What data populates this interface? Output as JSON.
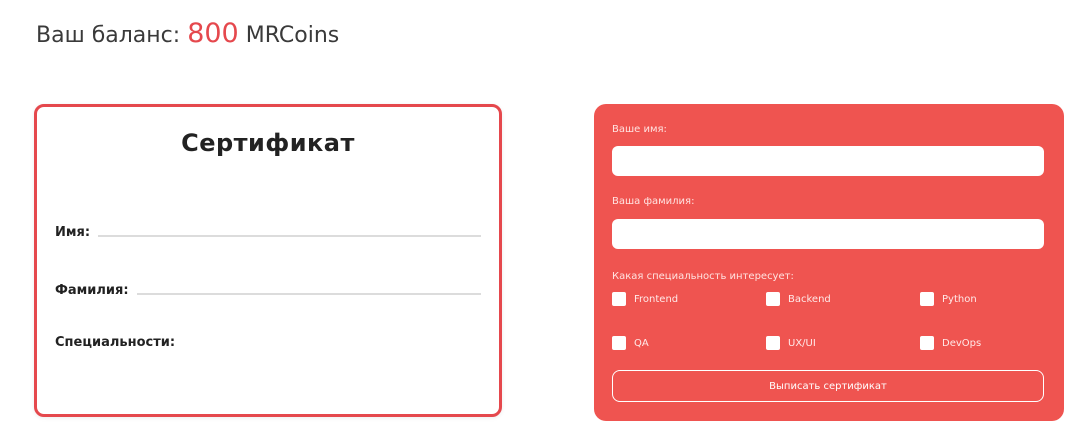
{
  "balance": {
    "label": "Ваш баланс:",
    "amount": "800",
    "currency": "MRCoins",
    "amount_color": "#e5484d"
  },
  "certificate": {
    "title": "Сертификат",
    "name_label": "Имя:",
    "surname_label": "Фамилия:",
    "specialty_label": "Специальности:",
    "border_color": "#e5484d"
  },
  "form": {
    "background_color": "#ef5450",
    "name_label": "Ваше имя:",
    "name_value": "",
    "surname_label": "Ваша фамилия:",
    "surname_value": "",
    "specialty_label": "Какая специальность интересует:",
    "specialties": [
      {
        "label": "Frontend",
        "checked": false
      },
      {
        "label": "Backend",
        "checked": false
      },
      {
        "label": "Python",
        "checked": false
      },
      {
        "label": "QA",
        "checked": false
      },
      {
        "label": "UX/UI",
        "checked": false
      },
      {
        "label": "DevOps",
        "checked": false
      }
    ],
    "submit_label": "Выписать сертификат"
  }
}
